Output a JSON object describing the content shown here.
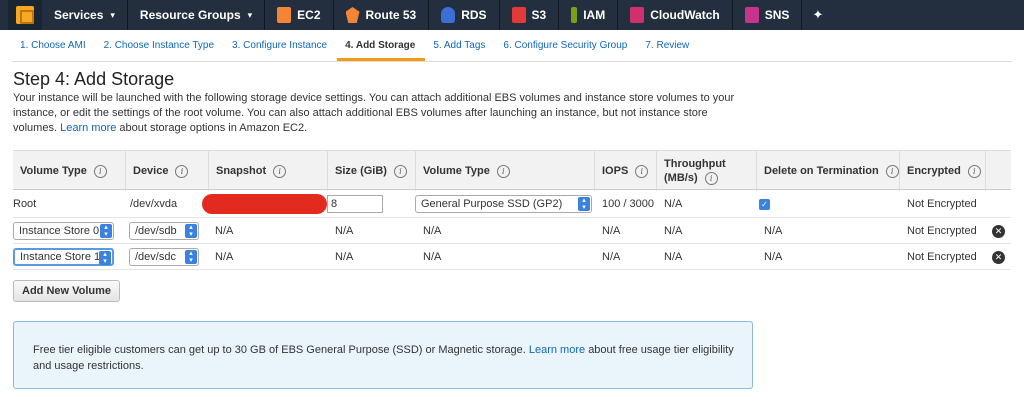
{
  "nav": {
    "services": "Services",
    "resource_groups": "Resource Groups",
    "items": [
      "EC2",
      "Route 53",
      "RDS",
      "S3",
      "IAM",
      "CloudWatch",
      "SNS"
    ]
  },
  "steps": [
    "1. Choose AMI",
    "2. Choose Instance Type",
    "3. Configure Instance",
    "4. Add Storage",
    "5. Add Tags",
    "6. Configure Security Group",
    "7. Review"
  ],
  "active_step": "4. Add Storage",
  "page": {
    "title": "Step 4: Add Storage",
    "desc_before_link": "Your instance will be launched with the following storage device settings. You can attach additional EBS volumes and instance store volumes to your instance, or edit the settings of the root volume. You can also attach additional EBS volumes after launching an instance, but not instance store volumes.",
    "desc_link": "Learn more",
    "desc_after_link": "about storage options in Amazon EC2."
  },
  "table": {
    "headers": {
      "volume_type": "Volume Type",
      "device": "Device",
      "snapshot": "Snapshot",
      "size": "Size (GiB)",
      "volume_type2": "Volume Type",
      "iops": "IOPS",
      "throughput_line1": "Throughput",
      "throughput_line2": "(MB/s)",
      "delete": "Delete on Termination",
      "encrypted": "Encrypted"
    },
    "rows": [
      {
        "volume_type": "Root",
        "device": "/dev/xvda",
        "size": "8",
        "vol_type2": "General Purpose SSD (GP2)",
        "iops": "100 / 3000",
        "throughput": "N/A",
        "delete_checked": true,
        "encrypted": "Not Encrypted"
      },
      {
        "volume_type": "Instance Store 0",
        "device": "/dev/sdb",
        "snapshot": "N/A",
        "size": "N/A",
        "vol_type2": "N/A",
        "iops": "N/A",
        "throughput": "N/A",
        "delete": "N/A",
        "encrypted": "Not Encrypted"
      },
      {
        "volume_type": "Instance Store 1",
        "device": "/dev/sdc",
        "snapshot": "N/A",
        "size": "N/A",
        "vol_type2": "N/A",
        "iops": "N/A",
        "throughput": "N/A",
        "delete": "N/A",
        "encrypted": "Not Encrypted"
      }
    ]
  },
  "add_volume_label": "Add New Volume",
  "notice": {
    "before_link": "Free tier eligible customers can get up to 30 GB of EBS General Purpose (SSD) or Magnetic storage.",
    "link": "Learn more",
    "after_link": "about free usage tier eligibility and usage restrictions."
  },
  "colors": {
    "nav_bg": "#232f3e",
    "link": "#1166bb",
    "active_tab": "#f39c12",
    "select_accent": "#3b82e0",
    "redaction": "#e22b1e"
  }
}
